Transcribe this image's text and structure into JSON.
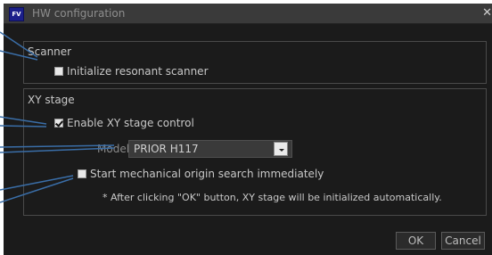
{
  "window": {
    "title": "HW configuration",
    "app_icon_text": "FV"
  },
  "scanner": {
    "title": "Scanner",
    "initialize_label": "Initialize resonant scanner",
    "initialize_checked": false
  },
  "xy_stage": {
    "title": "XY stage",
    "enable_label": "Enable XY stage control",
    "enable_checked": true,
    "model_label": "Model",
    "model_value": "PRIOR H117",
    "origin_search_label": "Start mechanical origin search immediately",
    "origin_search_checked": false,
    "note": "* After clicking \"OK\" button, XY stage will be initialized automatically."
  },
  "buttons": {
    "ok": "OK",
    "cancel": "Cancel"
  },
  "colors": {
    "callout_line": "#3a6ea8",
    "dialog_bg": "#1b1b1b",
    "titlebar_bg": "#3a3a3a"
  }
}
